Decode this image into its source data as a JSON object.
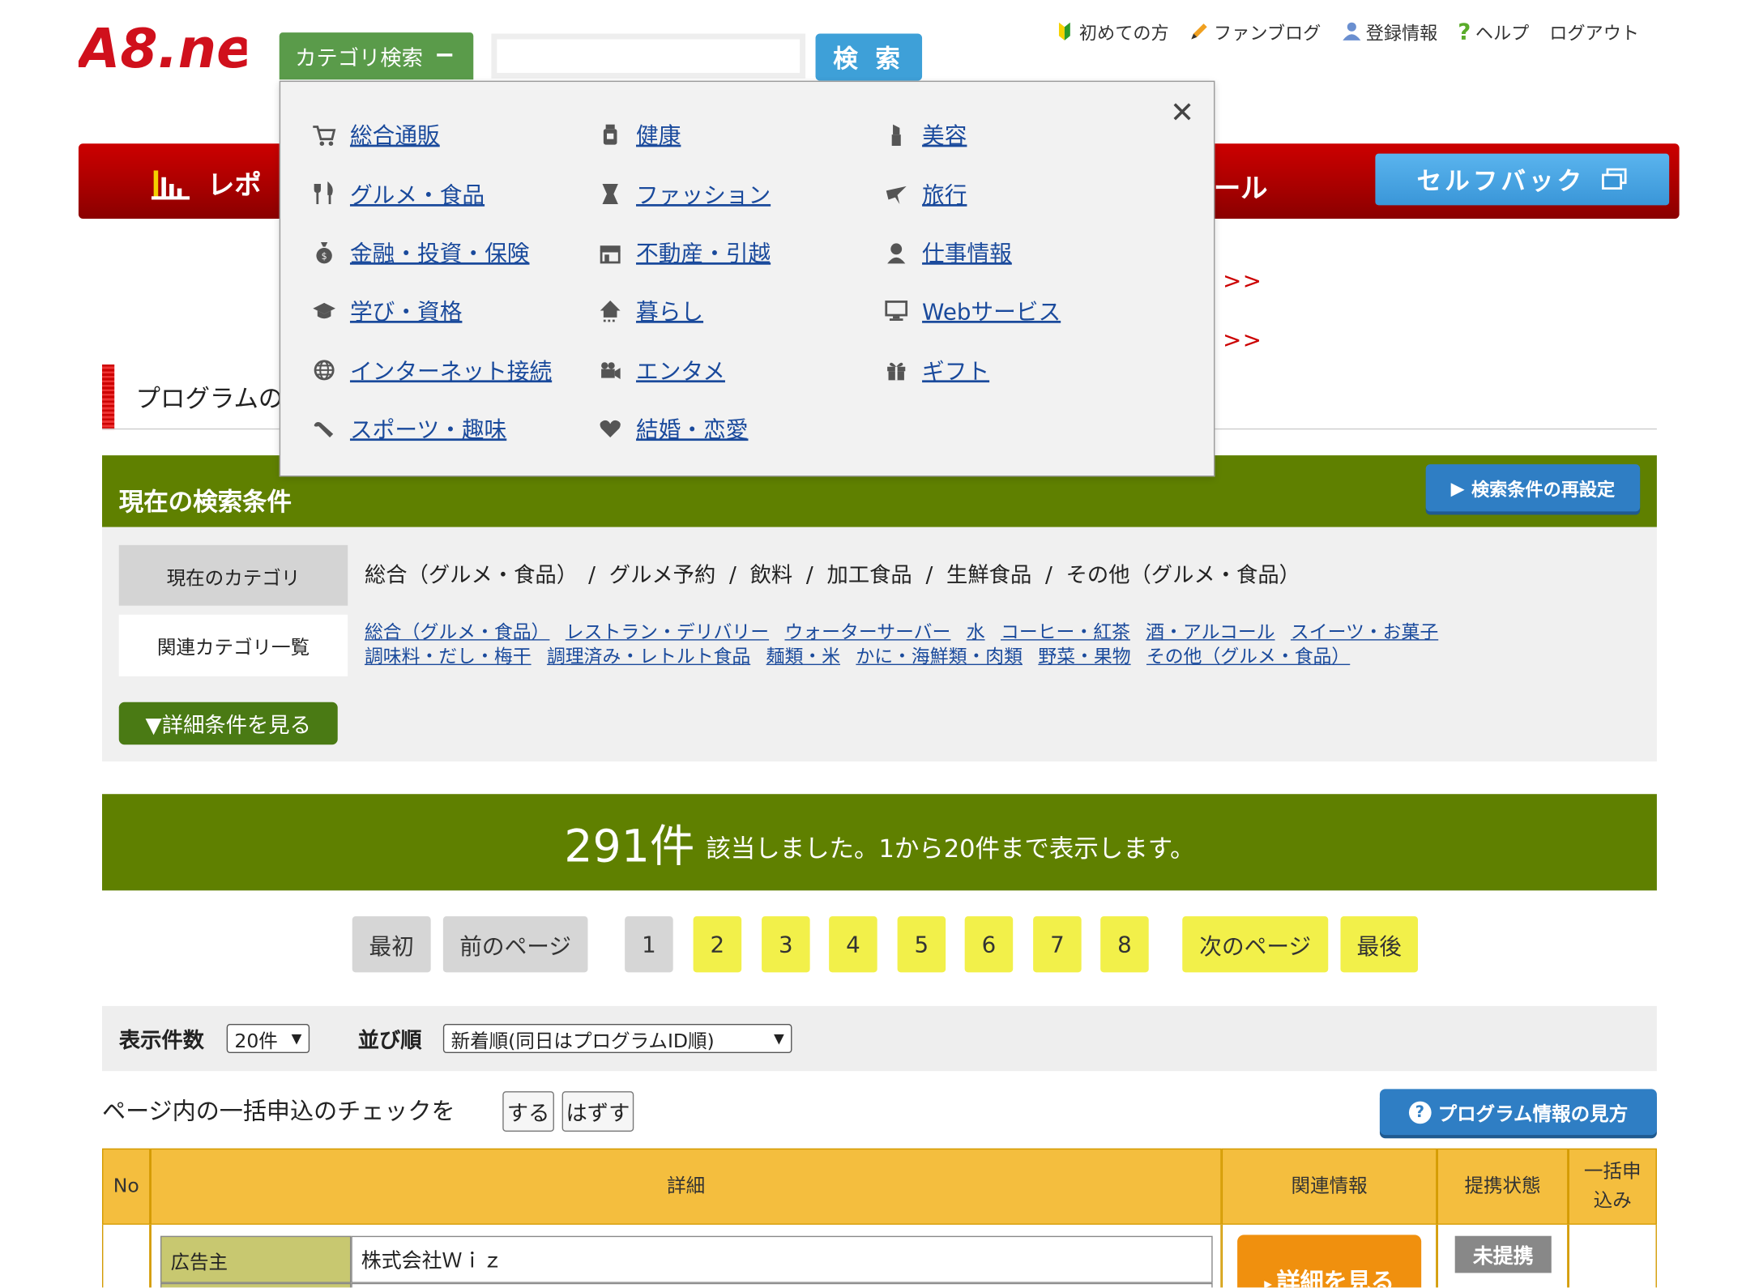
{
  "logo": {
    "text": "A8.net"
  },
  "header": {
    "category_search_label": "カテゴリ検索",
    "search_placeholder": "",
    "search_button": "検 索",
    "topnav": [
      {
        "label": "初めての方",
        "icon": "beginner-mark-icon"
      },
      {
        "label": "ファンブログ",
        "icon": "pencil-icon"
      },
      {
        "label": "登録情報",
        "icon": "user-icon"
      },
      {
        "label": "ヘルプ",
        "icon": "question-icon"
      },
      {
        "label": "ログアウト",
        "icon": ""
      }
    ]
  },
  "rednav": {
    "left_label": "レポ",
    "right_label": "ール",
    "selfback": "セルフバック"
  },
  "dropdown": {
    "close": "✕",
    "items": [
      {
        "label": "総合通販",
        "icon": "cart-icon"
      },
      {
        "label": "健康",
        "icon": "bottle-icon"
      },
      {
        "label": "美容",
        "icon": "lipstick-icon"
      },
      {
        "label": "グルメ・食品",
        "icon": "cutlery-icon"
      },
      {
        "label": "ファッション",
        "icon": "shirt-icon"
      },
      {
        "label": "旅行",
        "icon": "airplane-icon"
      },
      {
        "label": "金融・投資・保険",
        "icon": "money-bag-icon"
      },
      {
        "label": "不動産・引越",
        "icon": "shop-icon"
      },
      {
        "label": "仕事情報",
        "icon": "worker-icon"
      },
      {
        "label": "学び・資格",
        "icon": "graduation-cap-icon"
      },
      {
        "label": "暮らし",
        "icon": "house-icon"
      },
      {
        "label": "Webサービス",
        "icon": "monitor-icon"
      },
      {
        "label": "インターネット接続",
        "icon": "globe-icon"
      },
      {
        "label": "エンタメ",
        "icon": "video-camera-icon"
      },
      {
        "label": "ギフト",
        "icon": "gift-icon"
      },
      {
        "label": "スポーツ・趣味",
        "icon": "wrench-icon"
      },
      {
        "label": "結婚・恋愛",
        "icon": "heart-icon"
      }
    ]
  },
  "arrows": ">>",
  "page_heading": "プログラムの",
  "conditions": {
    "title": "現在の検索条件",
    "reset_button": "検索条件の再設定",
    "current_category_label": "現在のカテゴリ",
    "current_category_value": "総合（グルメ・食品）　/  グルメ予約  /  飲料  /  加工食品  /  生鮮食品  /  その他（グルメ・食品）",
    "related_label": "関連カテゴリ一覧",
    "related_links": [
      "総合（グルメ・食品）",
      "レストラン・デリバリー",
      "ウォーターサーバー",
      "水",
      "コーヒー・紅茶",
      "酒・アルコール",
      "スイーツ・お菓子",
      "調味料・だし・梅干",
      "調理済み・レトルト食品",
      "麺類・米",
      "かに・海鮮類・肉類",
      "野菜・果物",
      "その他（グルメ・食品）"
    ],
    "detail_button": "▼詳細条件を見る"
  },
  "result": {
    "count": "291件",
    "text": "該当しました。1から20件まで表示します。"
  },
  "pagination": {
    "first": "最初",
    "prev": "前のページ",
    "pages": [
      "1",
      "2",
      "3",
      "4",
      "5",
      "6",
      "7",
      "8"
    ],
    "current": "1",
    "next": "次のページ",
    "last": "最後"
  },
  "options": {
    "per_page_label": "表示件数",
    "per_page_value": "20件",
    "sort_label": "並び順",
    "sort_value": "新着順(同日はプログラムID順)"
  },
  "bulk": {
    "text": "ページ内の一括申込のチェックを",
    "check": "する",
    "uncheck": "はずす",
    "howto": "プログラム情報の見方"
  },
  "table": {
    "headers": [
      "No",
      "詳細",
      "関連情報",
      "提携状態",
      "一括申込み"
    ],
    "row": {
      "advertiser_label": "広告主",
      "advertiser_value": "株式会社Ｗｉｚ",
      "see_detail": "詳細を見る",
      "status": "未提携"
    }
  },
  "colors": {
    "green": "#5f8000",
    "red": "#b30000",
    "blue": "#2f7ec4",
    "yellow": "#f2f04a",
    "orange": "#f0900e"
  }
}
